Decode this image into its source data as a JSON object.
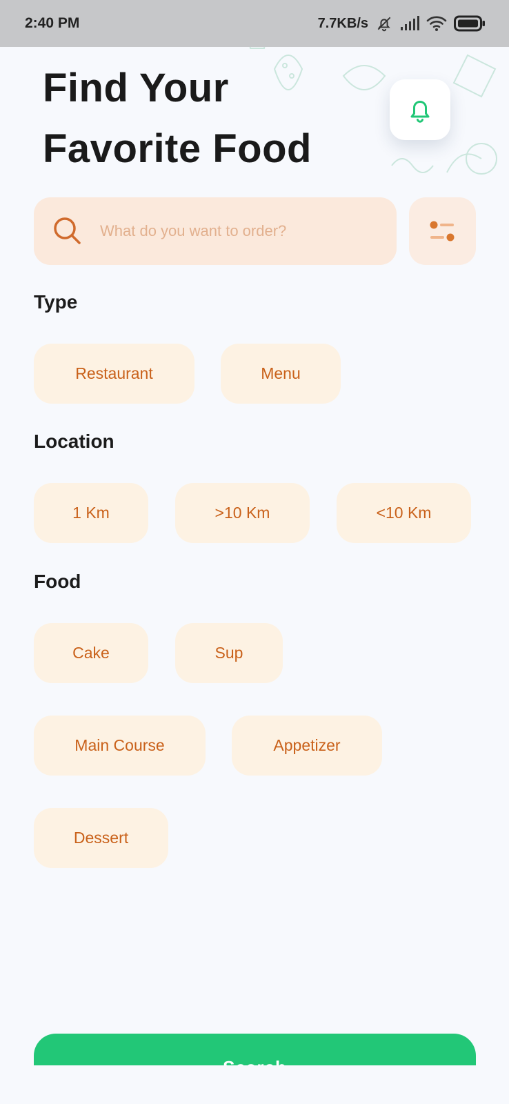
{
  "status_bar": {
    "time": "2:40 PM",
    "network_speed": "7.7KB/s",
    "icons": [
      "bell-off-icon",
      "signal-icon",
      "wifi-icon",
      "battery-icon"
    ]
  },
  "header": {
    "title_line1": "Find Your",
    "title_line2": "Favorite Food",
    "bell_icon": "bell-icon"
  },
  "search": {
    "placeholder": "What do you want to order?",
    "icon": "search-icon",
    "filter_icon": "filter-icon"
  },
  "sections": {
    "type": {
      "heading": "Type",
      "chips": [
        "Restaurant",
        "Menu"
      ]
    },
    "location": {
      "heading": "Location",
      "chips": [
        "1 Km",
        ">10 Km",
        "<10 Km"
      ]
    },
    "food": {
      "heading": "Food",
      "chips": [
        "Cake",
        "Sup",
        "Main Course",
        "Appetizer",
        "Dessert"
      ]
    }
  },
  "footer": {
    "search_button": "Search"
  },
  "colors": {
    "accent_green": "#22c777",
    "chip_bg": "#fdf2e3",
    "chip_text": "#c9611a",
    "search_bg": "#fbe9dc"
  }
}
